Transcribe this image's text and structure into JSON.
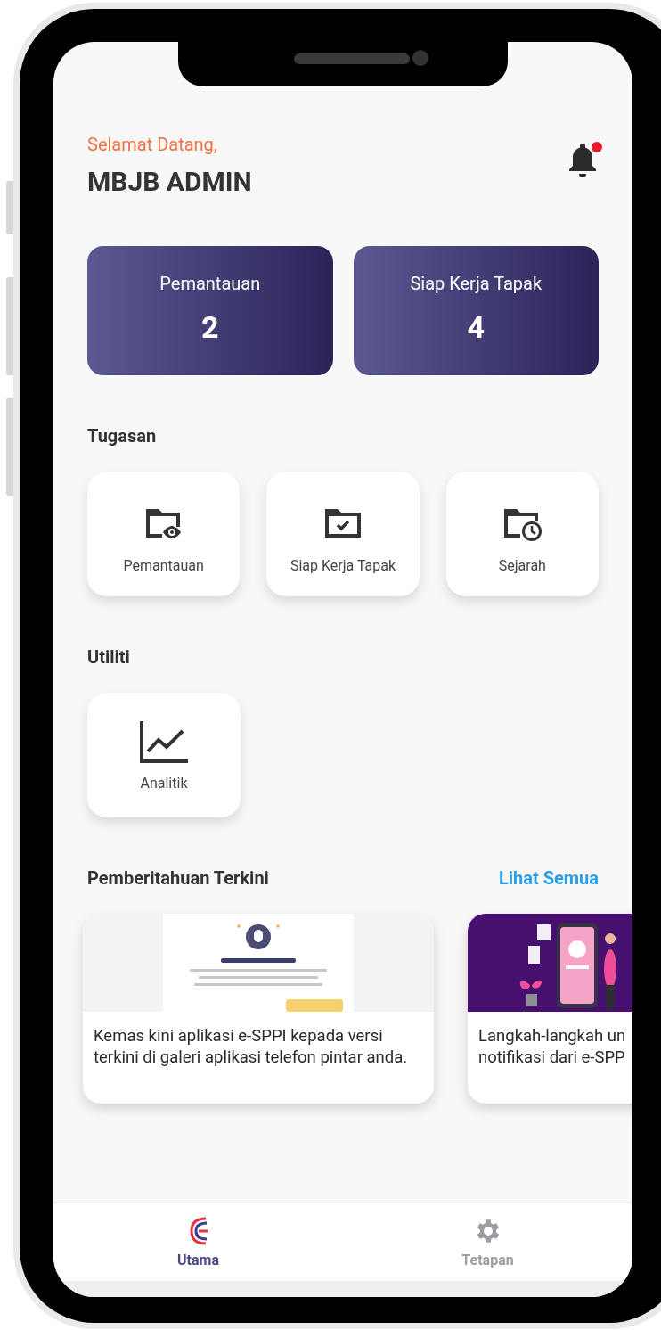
{
  "greeting": "Selamat Datang,",
  "user_name": "MBJB ADMIN",
  "notifications_unread": true,
  "stats": [
    {
      "label": "Pemantauan",
      "value": "2"
    },
    {
      "label": "Siap Kerja Tapak",
      "value": "4"
    }
  ],
  "tasks": {
    "title": "Tugasan",
    "items": [
      {
        "label": "Pemantauan",
        "kind": "monitoring"
      },
      {
        "label": "Siap Kerja Tapak",
        "kind": "ready"
      },
      {
        "label": "Sejarah",
        "kind": "history"
      }
    ]
  },
  "utilities": {
    "title": "Utiliti",
    "items": [
      {
        "label": "Analitik",
        "kind": "analytics"
      }
    ]
  },
  "news": {
    "title": "Pemberitahuan Terkini",
    "link": "Lihat Semua",
    "items": [
      {
        "kind": "picture",
        "lines": [
          "Kemas kini aplikasi e-SPPI kepada versi",
          "terkini di galeri aplikasi telefon pintar anda."
        ]
      },
      {
        "kind": "illustration",
        "lines": [
          "Langkah-langkah un",
          "notifikasi dari e-SPP"
        ]
      }
    ]
  },
  "nav": [
    {
      "label": "Utama",
      "kind": "home",
      "selected": true
    },
    {
      "label": "Tetapan",
      "kind": "settings",
      "selected": false
    }
  ]
}
